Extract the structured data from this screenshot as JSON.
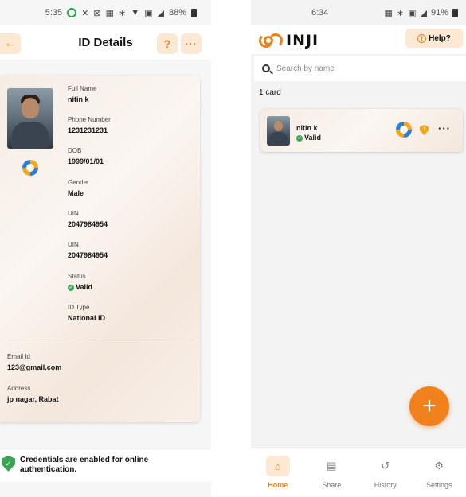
{
  "left": {
    "status": {
      "time": "5:35",
      "battery": "88%",
      "glyphs": [
        "✕",
        "⊠",
        "▦",
        "∗",
        "▼",
        "▣",
        "◢"
      ]
    },
    "header": {
      "title": "ID Details",
      "back_icon": "arrow-left-icon",
      "help_label": "?",
      "more_label": "···"
    },
    "card": {
      "fields": [
        {
          "label": "Full Name",
          "value": "nitin k"
        },
        {
          "label": "Phone Number",
          "value": "1231231231"
        },
        {
          "label": "DOB",
          "value": "1999/01/01"
        },
        {
          "label": "Gender",
          "value": "Male"
        },
        {
          "label": "UIN",
          "value": "2047984954"
        },
        {
          "label": "UIN",
          "value": "2047984954"
        },
        {
          "label": "Status",
          "value": "Valid"
        },
        {
          "label": "ID Type",
          "value": "National ID"
        }
      ],
      "bottom_fields": [
        {
          "label": "Email Id",
          "value": "123@gmail.com"
        },
        {
          "label": "Address",
          "value": "jp nagar, Rabat"
        }
      ]
    },
    "notice": "Credentials are enabled for online authentication."
  },
  "right": {
    "status": {
      "time": "6:34",
      "battery": "91%",
      "glyphs": [
        "▦",
        "∗",
        "▣",
        "◢"
      ]
    },
    "brand": "INJI",
    "help_label": "Help?",
    "search_placeholder": "Search by name",
    "count": "1 card",
    "card": {
      "name": "nitin k",
      "status": "Valid",
      "more": "···"
    },
    "fab_label": "+",
    "tabs": [
      {
        "label": "Home",
        "icon": "home-icon",
        "glyph": "⌂",
        "active": true
      },
      {
        "label": "Share",
        "icon": "scan-icon",
        "glyph": "▤",
        "active": false
      },
      {
        "label": "History",
        "icon": "history-icon",
        "glyph": "↺",
        "active": false
      },
      {
        "label": "Settings",
        "icon": "gear-icon",
        "glyph": "⚙",
        "active": false
      }
    ]
  },
  "colors": {
    "accent": "#e8841a",
    "valid": "#3aa655",
    "accent_soft": "#fde8d4"
  }
}
